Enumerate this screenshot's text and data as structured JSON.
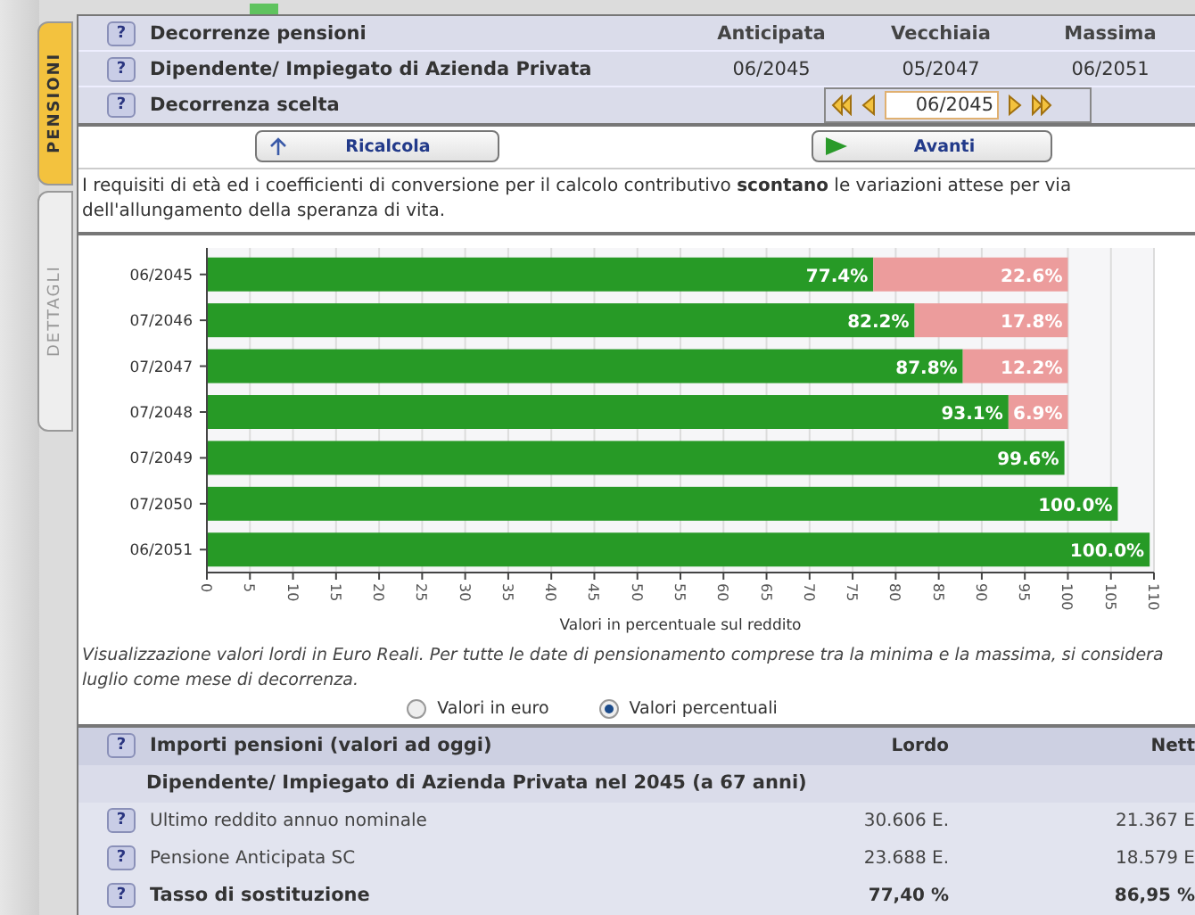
{
  "side_tabs": [
    {
      "label": "PENSIONI",
      "selected": true
    },
    {
      "label": "DETTAGLI",
      "selected": false
    }
  ],
  "decorrenze": {
    "header": {
      "help": "?",
      "label": "Decorrenze pensioni",
      "columns": [
        "Anticipata",
        "Vecchiaia",
        "Massima"
      ]
    },
    "row": {
      "help": "?",
      "label": "Dipendente/ Impiegato di Azienda Privata",
      "values": [
        "06/2045",
        "05/2047",
        "06/2051"
      ]
    },
    "chosen": {
      "help": "?",
      "label": "Decorrenza scelta",
      "value": "06/2045"
    }
  },
  "buttons": [
    {
      "label": "Ricalcola",
      "kind": "recalc"
    },
    {
      "label": "Avanti",
      "kind": "next"
    }
  ],
  "note": "I requisiti di età ed i coefficienti di conversione per il calcolo contributivo **scontano** le variazioni attese per via dell'allungamento della speranza di vita.",
  "chart": {
    "chart_data": {
      "type": "bar",
      "orientation": "horizontal",
      "stacked": true,
      "grid": true,
      "xlabel": "Valori in percentuale sul reddito",
      "categories": [
        "06/2045",
        "07/2046",
        "07/2047",
        "07/2048",
        "07/2049",
        "07/2050",
        "06/2051"
      ],
      "xlim": [
        0,
        110
      ],
      "xticks": [
        0,
        5,
        10,
        15,
        20,
        25,
        30,
        35,
        40,
        45,
        50,
        55,
        60,
        65,
        70,
        75,
        80,
        85,
        90,
        95,
        100,
        105,
        110
      ],
      "series": [
        {
          "color": "#279a26",
          "values": [
            77.4,
            82.2,
            87.8,
            93.1,
            99.6,
            105.8,
            109.5
          ],
          "value_labels": [
            "77.4%",
            "82.2%",
            "87.8%",
            "93.1%",
            "99.6%",
            null,
            null
          ]
        },
        {
          "color": "#ec9c9c",
          "values": [
            22.6,
            17.8,
            12.2,
            6.9,
            null,
            null,
            null
          ],
          "value_labels": [
            "22.6%",
            "17.8%",
            "12.2%",
            "6.9%",
            null,
            null,
            null
          ]
        }
      ],
      "annotations": [
        "100.0%",
        "100.0%"
      ]
    }
  },
  "chart_note": "Visualizzazione valori lordi in Euro Reali. Per tutte le date di pensionamento comprese tra la minima e la massima, si considera luglio come mese di decorrenza.",
  "view_options": [
    {
      "label": "Valori in euro",
      "selected": false
    },
    {
      "label": "Valori percentuali",
      "selected": true
    }
  ],
  "importi": {
    "header": {
      "help": "?",
      "label": "Importi pensioni (valori ad oggi)",
      "columns": [
        "Lordo",
        "Nett"
      ]
    },
    "subtitle": "Dipendente/ Impiegato di Azienda Privata nel 2045 (a 67 anni)",
    "rows": [
      {
        "help": "?",
        "label": "Ultimo reddito annuo nominale",
        "lordo": "30.606 E.",
        "netto": "21.367 E",
        "kind": "plain"
      },
      {
        "help": "?",
        "label": "Pensione Anticipata SC",
        "lordo": "23.688 E.",
        "netto": "18.579 E",
        "kind": "plain"
      },
      {
        "help": "?",
        "label": "Tasso di sostituzione",
        "lordo": "77,40 %",
        "netto": "86,95 %",
        "kind": "bold"
      }
    ]
  }
}
